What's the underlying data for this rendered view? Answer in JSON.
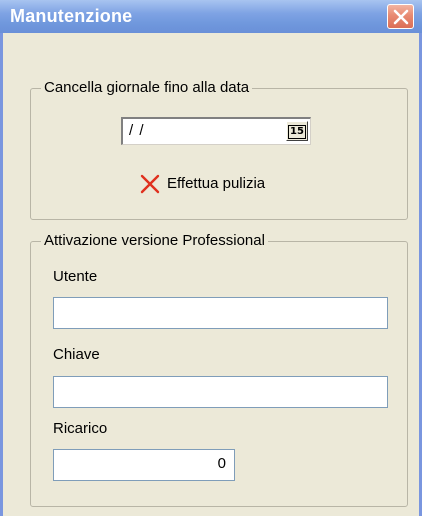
{
  "window": {
    "title": "Manutenzione",
    "close_icon": "close-x-icon",
    "accent_color": "#7098dd",
    "close_color": "#dc6f57"
  },
  "cleanup_group": {
    "legend": "Cancella giornale fino alla data",
    "date_value": "/ /",
    "calendar_button_label": "15",
    "clean_button_label": "Effettua pulizia",
    "clean_icon": "red-x-icon"
  },
  "activation_group": {
    "legend": "Attivazione versione Professional",
    "user_label": "Utente",
    "user_value": "",
    "key_label": "Chiave",
    "key_value": "",
    "reload_label": "Ricarico",
    "reload_value": "0"
  }
}
